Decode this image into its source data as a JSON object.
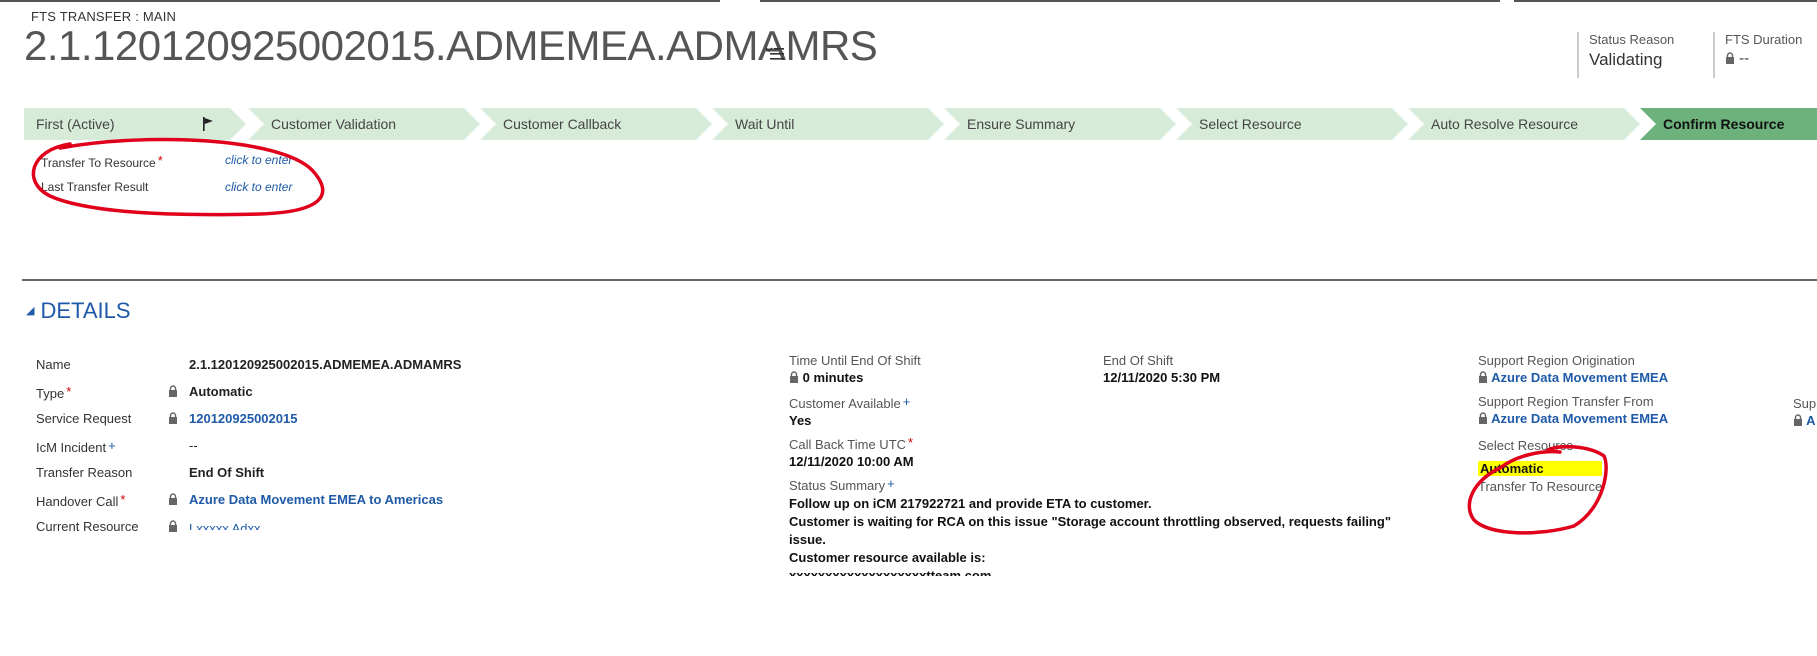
{
  "header": {
    "entity_label": "FTS TRANSFER : MAIN",
    "record_title": "2.1.120120925002015.ADMEMEA.ADMAMRS",
    "status_reason_label": "Status Reason",
    "status_reason_value": "Validating",
    "fts_duration_label": "FTS Duration",
    "fts_duration_value": "--"
  },
  "process_stages": [
    {
      "label": "First (Active)",
      "active": false
    },
    {
      "label": "Customer Validation",
      "active": false
    },
    {
      "label": "Customer Callback",
      "active": false
    },
    {
      "label": "Wait Until",
      "active": false
    },
    {
      "label": "Ensure Summary",
      "active": false
    },
    {
      "label": "Select Resource",
      "active": false
    },
    {
      "label": "Auto Resolve Resource",
      "active": false
    },
    {
      "label": "Confirm Resource",
      "active": true
    }
  ],
  "stage_fields": [
    {
      "label": "Transfer To Resource",
      "required": true,
      "value": "click to enter"
    },
    {
      "label": "Last Transfer Result",
      "required": false,
      "value": "click to enter"
    }
  ],
  "details": {
    "section_title": "DETAILS",
    "col1": [
      {
        "label": "Name",
        "value": "2.1.120120925002015.ADMEMEA.ADMAMRS"
      },
      {
        "label": "Type",
        "req": "*",
        "value": "Automatic"
      },
      {
        "label": "Service Request",
        "value": "120120925002015"
      },
      {
        "label": "IcM Incident",
        "req": "+",
        "value": "--"
      },
      {
        "label": "Transfer Reason",
        "value": "End Of Shift"
      },
      {
        "label": "Handover Call",
        "req": "*",
        "value": "Azure Data Movement EMEA to Americas"
      },
      {
        "label": "Current Resource",
        "value": "Lxxxxx Adxx"
      }
    ],
    "col2": {
      "time_until_label": "Time Until End Of Shift",
      "time_until_value": "0 minutes",
      "customer_available_label": "Customer Available",
      "customer_available_value": "Yes",
      "callback_label": "Call Back Time UTC",
      "callback_value": "12/11/2020  10:00 AM",
      "status_summary_label": "Status Summary",
      "status_summary_lines": [
        "Follow up on iCM 217922721 and provide ETA to customer.",
        "Customer is waiting for RCA on this issue \"Storage account throttling observed, requests failing\" issue.",
        "Customer resource available is:",
        "xxxxxxxxxxxxxxxxxxxtteam.com"
      ]
    },
    "col3": {
      "end_of_shift_label": "End Of Shift",
      "end_of_shift_value": "12/11/2020  5:30 PM"
    },
    "col4": {
      "origination_label": "Support Region Origination",
      "origination_value": "Azure Data Movement EMEA",
      "transfer_from_label": "Support Region Transfer From",
      "transfer_from_value": "Azure Data Movement EMEA",
      "select_resource_label": "Select Resource",
      "select_resource_value": "Automatic",
      "transfer_to_label": "Transfer To Resource",
      "transfer_to_value": "--"
    },
    "col5": {
      "label": "Supp",
      "value": "A"
    }
  }
}
